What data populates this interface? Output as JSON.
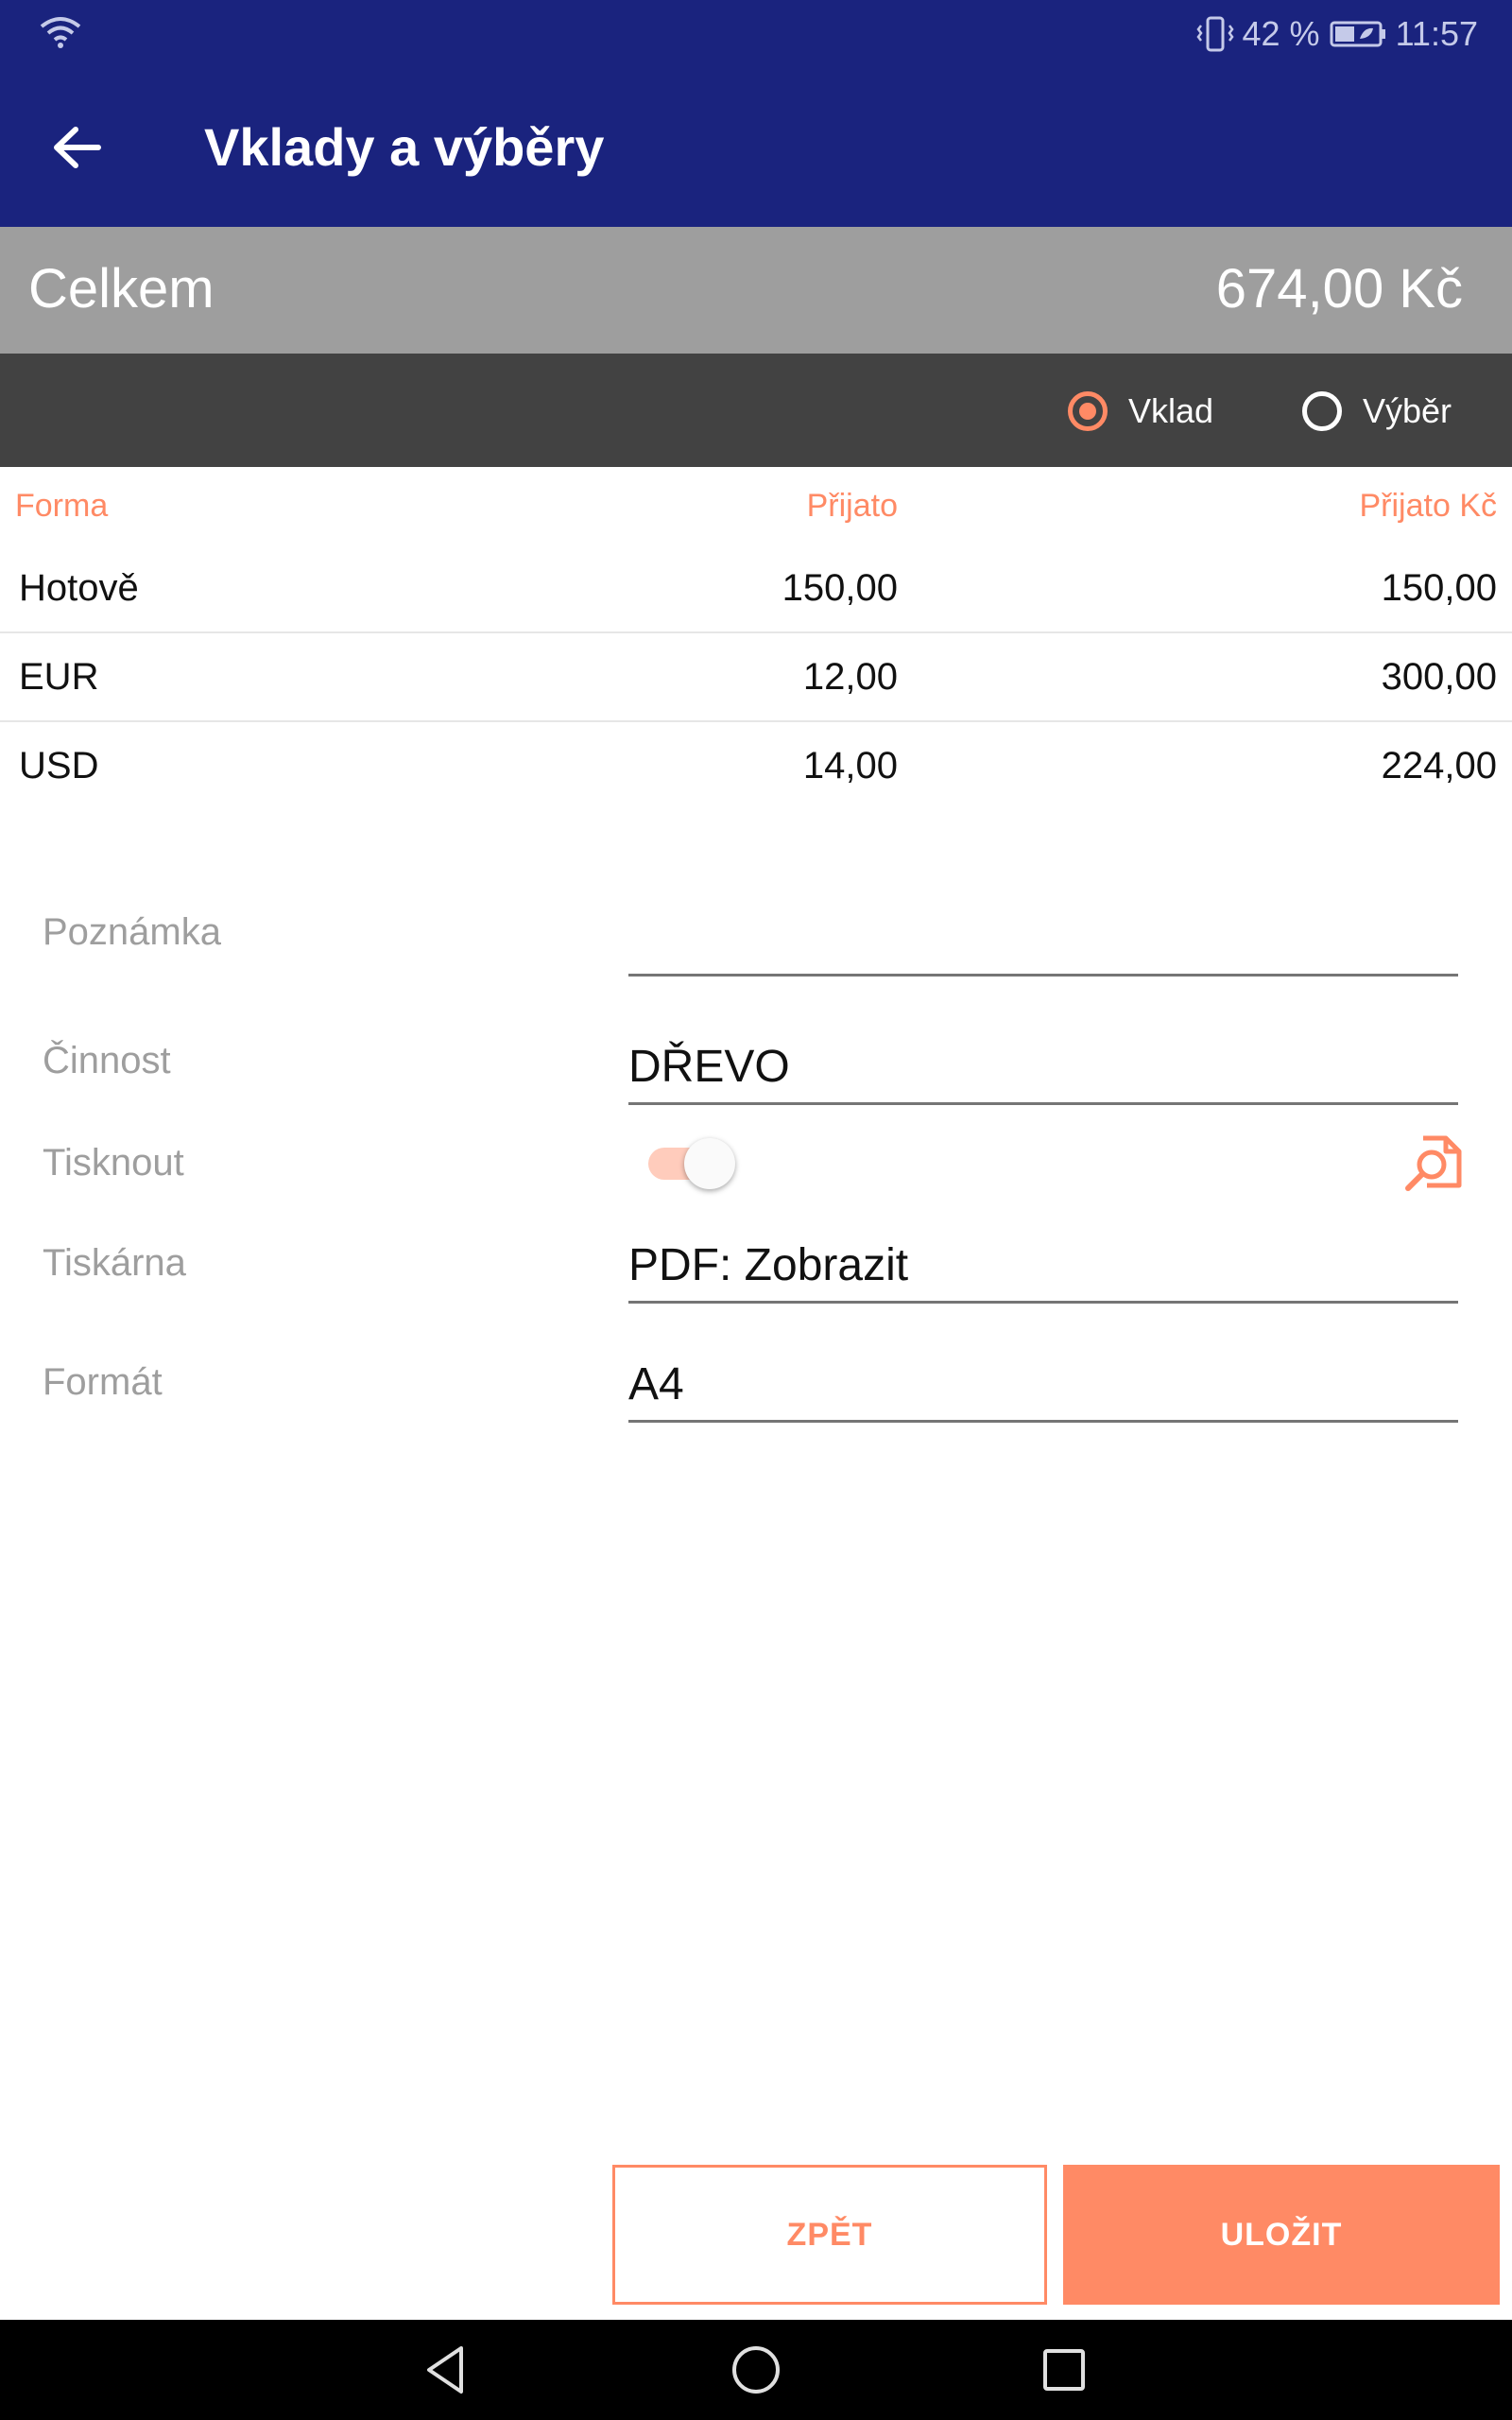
{
  "status_bar": {
    "battery": "42 %",
    "time": "11:57",
    "icons": [
      "wifi-icon",
      "vibrate-icon",
      "battery-charging-icon"
    ]
  },
  "app_bar": {
    "title": "Vklady a výběry",
    "back_icon": "arrow-back-icon"
  },
  "summary": {
    "label": "Celkem",
    "value": "674,00 Kč"
  },
  "type_selector": {
    "options": [
      {
        "label": "Vklad",
        "selected": true
      },
      {
        "label": "Výběr",
        "selected": false
      }
    ]
  },
  "table": {
    "headers": [
      "Forma",
      "Přijato",
      "Přijato Kč"
    ],
    "rows": [
      [
        "Hotově",
        "150,00",
        "150,00"
      ],
      [
        "EUR",
        "12,00",
        "300,00"
      ],
      [
        "USD",
        "14,00",
        "224,00"
      ]
    ]
  },
  "form": {
    "note": {
      "label": "Poznámka",
      "value": ""
    },
    "activity": {
      "label": "Činnost",
      "value": "DŘEVO"
    },
    "print": {
      "label": "Tisknout",
      "enabled": true,
      "preview_icon": "print-preview-icon"
    },
    "printer": {
      "label": "Tiskárna",
      "value": "PDF: Zobrazit"
    },
    "format": {
      "label": "Formát",
      "value": "A4"
    }
  },
  "actions": {
    "back_label": "ZPĚT",
    "save_label": "ULOŽIT"
  },
  "nav_bar": {
    "icons": [
      "nav-back-icon",
      "nav-home-icon",
      "nav-recents-icon"
    ]
  },
  "colors": {
    "primary": "#1a237e",
    "accent": "#ff8a65",
    "summary_bg": "#9e9e9e",
    "selector_bg": "#424242"
  }
}
